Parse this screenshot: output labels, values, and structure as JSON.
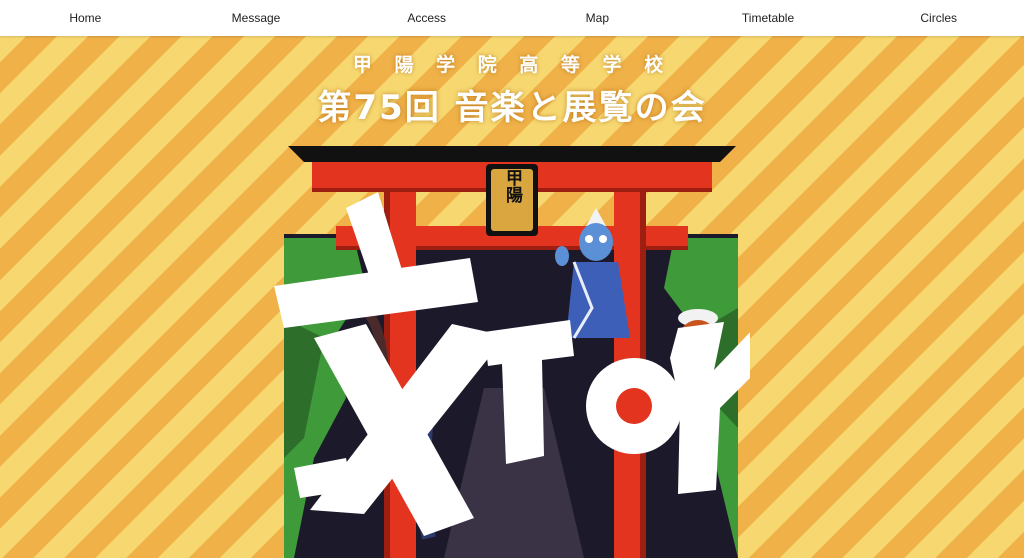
{
  "nav": {
    "items": [
      {
        "label": "Home"
      },
      {
        "label": "Message"
      },
      {
        "label": "Access"
      },
      {
        "label": "Map"
      },
      {
        "label": "Timetable"
      },
      {
        "label": "Circles"
      }
    ]
  },
  "header": {
    "school_name": "甲 陽 学 院 高 等 学 校",
    "event_title": "第75回 音楽と展覧の会"
  },
  "poster": {
    "plaque_text": "甲陽",
    "logo_text": "文JOY",
    "colors": {
      "torii_red": "#e2341f",
      "torii_black": "#111111",
      "plaque_gold": "#d9a640",
      "forest_green": "#3f9a3a",
      "stripe_light": "#f7d870",
      "stripe_dark": "#efb148"
    }
  }
}
